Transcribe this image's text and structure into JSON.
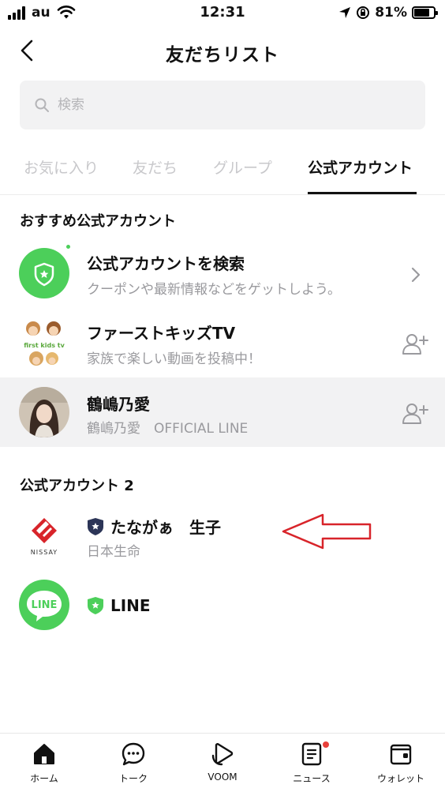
{
  "status_bar": {
    "carrier": "au",
    "time": "12:31",
    "battery_percent": "81%",
    "battery_level": 0.81
  },
  "header": {
    "title": "友だちリスト",
    "back_icon": "chevron-left-icon"
  },
  "search": {
    "placeholder": "検索",
    "value": ""
  },
  "tabs": [
    {
      "label": "お気に入り",
      "active": false
    },
    {
      "label": "友だち",
      "active": false
    },
    {
      "label": "グループ",
      "active": false
    },
    {
      "label": "公式アカウント",
      "active": true
    }
  ],
  "recommended": {
    "section_title": "おすすめ公式アカウント",
    "items": [
      {
        "title": "公式アカウントを検索",
        "subtitle": "クーポンや最新情報などをゲットしよう。",
        "action_icon": "chevron-right-icon"
      },
      {
        "title": "ファーストキッズTV",
        "subtitle": "家族で楽しい動画を投稿中！",
        "action_icon": "add-friend-icon",
        "logo_text": "first kids tv"
      },
      {
        "title": "鶴嶋乃愛",
        "subtitle": "鶴嶋乃愛　OFFICIAL LINE",
        "action_icon": "add-friend-icon"
      }
    ]
  },
  "official_accounts": {
    "section_title": "公式アカウント 2",
    "items": [
      {
        "title": "たながぁ　生子",
        "subtitle": "日本生命",
        "badge": "navy-shield-icon",
        "logo_text": "NISSAY"
      },
      {
        "title": "LINE",
        "badge": "green-shield-icon",
        "logo_text": "LINE"
      }
    ]
  },
  "bottom_nav": [
    {
      "label": "ホーム",
      "icon": "home-icon",
      "notification": false
    },
    {
      "label": "トーク",
      "icon": "chat-icon",
      "notification": false
    },
    {
      "label": "VOOM",
      "icon": "voom-icon",
      "notification": false
    },
    {
      "label": "ニュース",
      "icon": "news-icon",
      "notification": true
    },
    {
      "label": "ウォレット",
      "icon": "wallet-icon",
      "notification": false
    }
  ],
  "colors": {
    "line_green": "#4ccf5a",
    "navy": "#2c3557",
    "annotation_red": "#d8242a",
    "muted_text": "#9a9a9e"
  }
}
